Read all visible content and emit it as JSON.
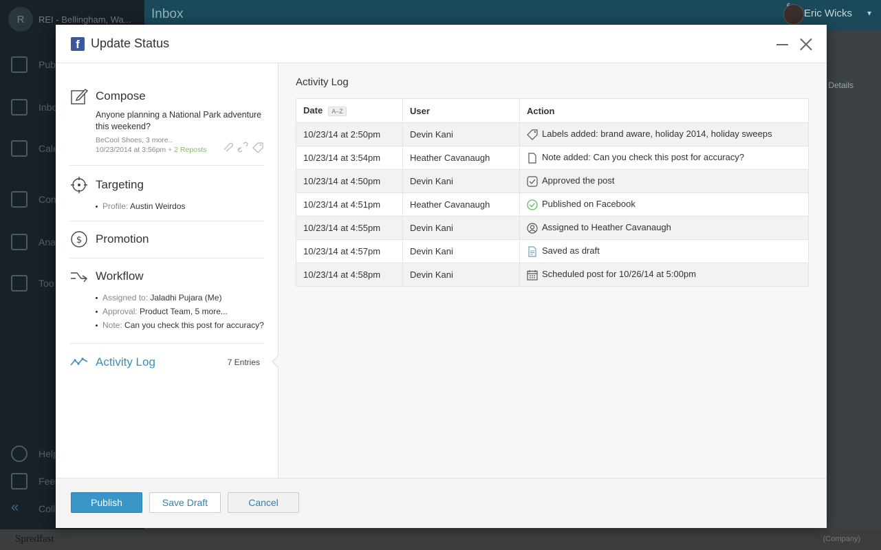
{
  "background": {
    "brand_initial": "R",
    "brand_name": "REI - Bellingham, Wa...",
    "nav_items": [
      "Pub",
      "Inbo",
      "Cale",
      "Con",
      "Ana",
      "Too"
    ],
    "footer_items": [
      "Help",
      "Feed",
      "Colla"
    ],
    "header_title": "Inbox",
    "user_name": "Eric Wicks",
    "notification_count": "6",
    "footer_brand": "Spredfast",
    "footer_company": "(Company)",
    "right_tab": "Details"
  },
  "modal": {
    "title": "Update Status",
    "compose": {
      "title": "Compose",
      "text": "Anyone planning a National Park adventure this weekend?",
      "meta_accounts": "BeCool Shoes, 3 more..",
      "meta_time": "10/23/2014 at 3:56pm",
      "meta_reposts": "+ 2 Reposts"
    },
    "targeting": {
      "title": "Targeting",
      "profile_label": "Profile:",
      "profile_value": "Austin Weirdos"
    },
    "promotion": {
      "title": "Promotion"
    },
    "workflow": {
      "title": "Workflow",
      "assigned_label": "Assigned to:",
      "assigned_value": "Jaladhi Pujara (Me)",
      "approval_label": "Approval:",
      "approval_value": "Product Team, 5 more...",
      "note_label": "Note:",
      "note_value": "Can you check this post for accuracy?"
    },
    "activity_nav": {
      "title": "Activity Log",
      "entries": "7 Entries"
    },
    "activity_log": {
      "title": "Activity Log",
      "columns": {
        "date": "Date",
        "sort": "A–Z",
        "user": "User",
        "action": "Action"
      },
      "rows": [
        {
          "date": "10/23/14 at 2:50pm",
          "user": "Devin Kani",
          "action": "Labels added: brand aware, holiday 2014, holiday sweeps",
          "icon": "tag-icon"
        },
        {
          "date": "10/23/14 at 3:54pm",
          "user": "Heather Cavanaugh",
          "action": "Note added: Can you check this post for accuracy?",
          "icon": "note-icon"
        },
        {
          "date": "10/23/14 at 4:50pm",
          "user": "Devin Kani",
          "action": "Approved the post",
          "icon": "approved-icon"
        },
        {
          "date": "10/23/14 at 4:51pm",
          "user": "Heather Cavanaugh",
          "action": "Published on Facebook",
          "icon": "published-icon"
        },
        {
          "date": "10/23/14 at 4:55pm",
          "user": "Devin Kani",
          "action": "Assigned to Heather Cavanaugh",
          "icon": "user-icon"
        },
        {
          "date": "10/23/14 at 4:57pm",
          "user": "Devin Kani",
          "action": "Saved as draft",
          "icon": "draft-icon"
        },
        {
          "date": "10/23/14 at 4:58pm",
          "user": "Devin Kani",
          "action": "Scheduled post for 10/26/14 at 5:00pm",
          "icon": "calendar-icon"
        }
      ]
    },
    "footer": {
      "publish": "Publish",
      "save_draft": "Save Draft",
      "cancel": "Cancel"
    }
  }
}
